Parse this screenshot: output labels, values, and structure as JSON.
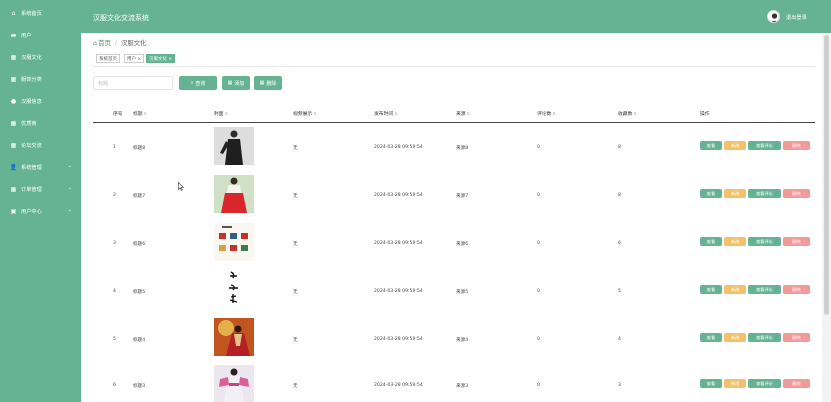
{
  "sidebar": {
    "items": [
      {
        "label": "系统首页",
        "icon": "home-icon"
      },
      {
        "label": "用户",
        "icon": "user-icon"
      },
      {
        "label": "汉服文化",
        "icon": "grid-icon"
      },
      {
        "label": "服饰分类",
        "icon": "grid-icon"
      },
      {
        "label": "汉服信息",
        "icon": "chat-icon"
      },
      {
        "label": "优质商",
        "icon": "grid-icon"
      },
      {
        "label": "论坛交流",
        "icon": "grid-icon"
      },
      {
        "label": "系统管理",
        "icon": "person-icon"
      },
      {
        "label": "订单管理",
        "icon": "grid-icon"
      },
      {
        "label": "用户中心",
        "icon": "card-icon"
      }
    ]
  },
  "header": {
    "title": "汉服文化交流系统",
    "logout": "退出登录"
  },
  "breadcrumb": {
    "home": "首页",
    "current": "汉服文化"
  },
  "tags": [
    "系统首页",
    "用户 ×",
    "汉服文化 ×"
  ],
  "search": {
    "placeholder": "标题",
    "search_label": "查询",
    "add_label": "添加",
    "delete_label": "删除"
  },
  "table": {
    "headers": [
      "序号",
      "标题",
      "封面",
      "视频展示",
      "发布时间",
      "来源",
      "评论数",
      "收藏数",
      "操作"
    ],
    "rows": [
      {
        "index": "1",
        "title": "标题8",
        "video": "无",
        "time": "2024-03-28 09:59:54",
        "source": "来源8",
        "comments": "0",
        "favorites": "8"
      },
      {
        "index": "2",
        "title": "标题7",
        "video": "无",
        "time": "2024-03-28 09:59:54",
        "source": "来源7",
        "comments": "0",
        "favorites": "8"
      },
      {
        "index": "3",
        "title": "标题6",
        "video": "无",
        "time": "2024-03-28 09:59:54",
        "source": "来源6",
        "comments": "0",
        "favorites": "6"
      },
      {
        "index": "4",
        "title": "标题5",
        "video": "无",
        "time": "2024-03-28 09:59:54",
        "source": "来源5",
        "comments": "0",
        "favorites": "5"
      },
      {
        "index": "5",
        "title": "标题4",
        "video": "无",
        "time": "2024-03-28 09:59:54",
        "source": "来源4",
        "comments": "0",
        "favorites": "4"
      },
      {
        "index": "6",
        "title": "标题3",
        "video": "无",
        "time": "2024-03-28 09:59:54",
        "source": "来源3",
        "comments": "0",
        "favorites": "3"
      }
    ],
    "ops": {
      "view": "查看",
      "edit": "修改",
      "comments": "查看评论",
      "delete": "删除"
    }
  },
  "colors": {
    "primary": "#66b394",
    "warning": "#f1c26b",
    "danger": "#f29a9a"
  }
}
